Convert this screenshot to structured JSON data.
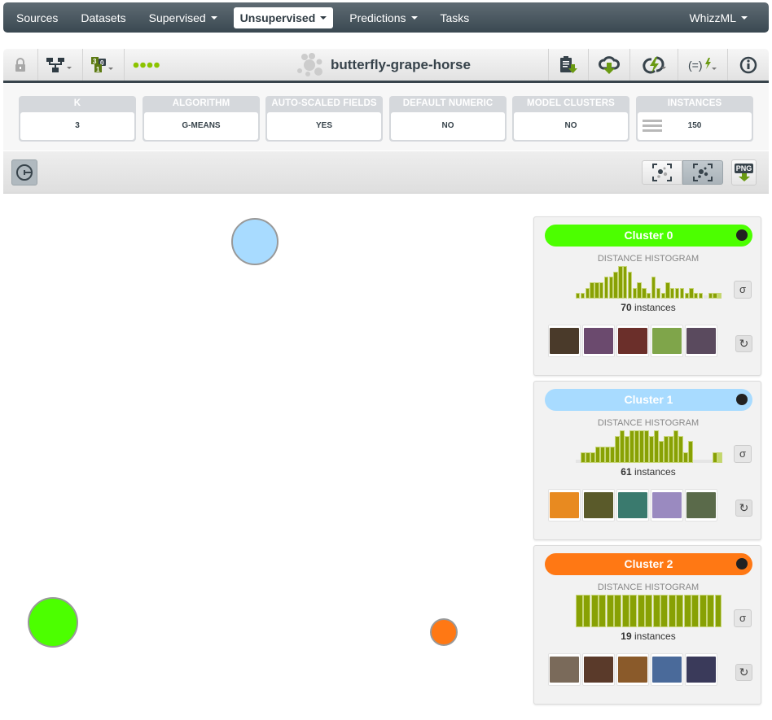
{
  "nav": {
    "items": [
      {
        "label": "Sources",
        "dropdown": false,
        "active": false
      },
      {
        "label": "Datasets",
        "dropdown": false,
        "active": false
      },
      {
        "label": "Supervised",
        "dropdown": true,
        "active": false
      },
      {
        "label": "Unsupervised",
        "dropdown": true,
        "active": true
      },
      {
        "label": "Predictions",
        "dropdown": true,
        "active": false
      },
      {
        "label": "Tasks",
        "dropdown": false,
        "active": false
      }
    ],
    "right": {
      "label": "WhizzML",
      "dropdown": true
    }
  },
  "toolbar": {
    "title": "butterfly-grape-horse",
    "left_icons": [
      "lock-icon",
      "model-tree-icon",
      "fields-icon",
      "status-dots-icon"
    ],
    "right_icons": [
      "download-report-icon",
      "cloud-download-icon",
      "batch-predict-icon",
      "formula-predict-icon",
      "info-icon"
    ]
  },
  "summary": {
    "stats": [
      {
        "label": "K",
        "value": "3"
      },
      {
        "label": "ALGORITHM",
        "value": "G-MEANS"
      },
      {
        "label": "AUTO-SCALED FIELDS",
        "value": "YES"
      },
      {
        "label": "DEFAULT NUMERIC",
        "value": "NO"
      },
      {
        "label": "MODEL CLUSTERS",
        "value": "NO"
      },
      {
        "label": "INSTANCES",
        "value": "150"
      }
    ]
  },
  "viewbar": {
    "png_label": "PNG"
  },
  "clusters": [
    {
      "name": "Cluster 0",
      "color": "#4cff00",
      "histogram_label": "DISTANCE HISTOGRAM",
      "histogram": [
        1,
        1,
        2,
        3,
        3,
        3,
        4,
        4,
        5,
        6,
        6,
        5,
        2,
        3,
        2,
        1,
        4,
        2,
        1,
        3,
        2,
        2,
        2,
        1,
        2,
        1,
        1,
        0,
        1,
        1,
        1
      ],
      "instances_count": "70",
      "instances_label": "instances",
      "thumbs": [
        "#4a3a2a",
        "#6b4a6e",
        "#6b2f2a",
        "#7fa54a",
        "#5a4a5e"
      ],
      "sigma": "σ"
    },
    {
      "name": "Cluster 1",
      "color": "#a8dbff",
      "histogram_label": "DISTANCE HISTOGRAM",
      "histogram": [
        0,
        2,
        2,
        2,
        3,
        3,
        3,
        3,
        5,
        6,
        5,
        6,
        6,
        6,
        6,
        5,
        6,
        4,
        5,
        5,
        6,
        5,
        2,
        4,
        0,
        0,
        0,
        0,
        2,
        2
      ],
      "instances_count": "61",
      "instances_label": "instances",
      "thumbs": [
        "#e88a20",
        "#5a5a2a",
        "#3a7a6e",
        "#9a8ac0",
        "#5a6a4a"
      ],
      "sigma": "σ"
    },
    {
      "name": "Cluster 2",
      "color": "#ff7814",
      "histogram_label": "DISTANCE HISTOGRAM",
      "histogram": [
        1,
        1,
        1,
        1,
        1,
        1,
        1,
        1,
        1,
        1,
        1,
        1,
        1,
        1,
        1,
        1,
        1,
        1,
        1
      ],
      "instances_count": "19",
      "instances_label": "instances",
      "thumbs": [
        "#7a6a5a",
        "#5a3a2a",
        "#8a5a2a",
        "#4a6a9a",
        "#3a3a5a"
      ],
      "sigma": "σ"
    }
  ]
}
